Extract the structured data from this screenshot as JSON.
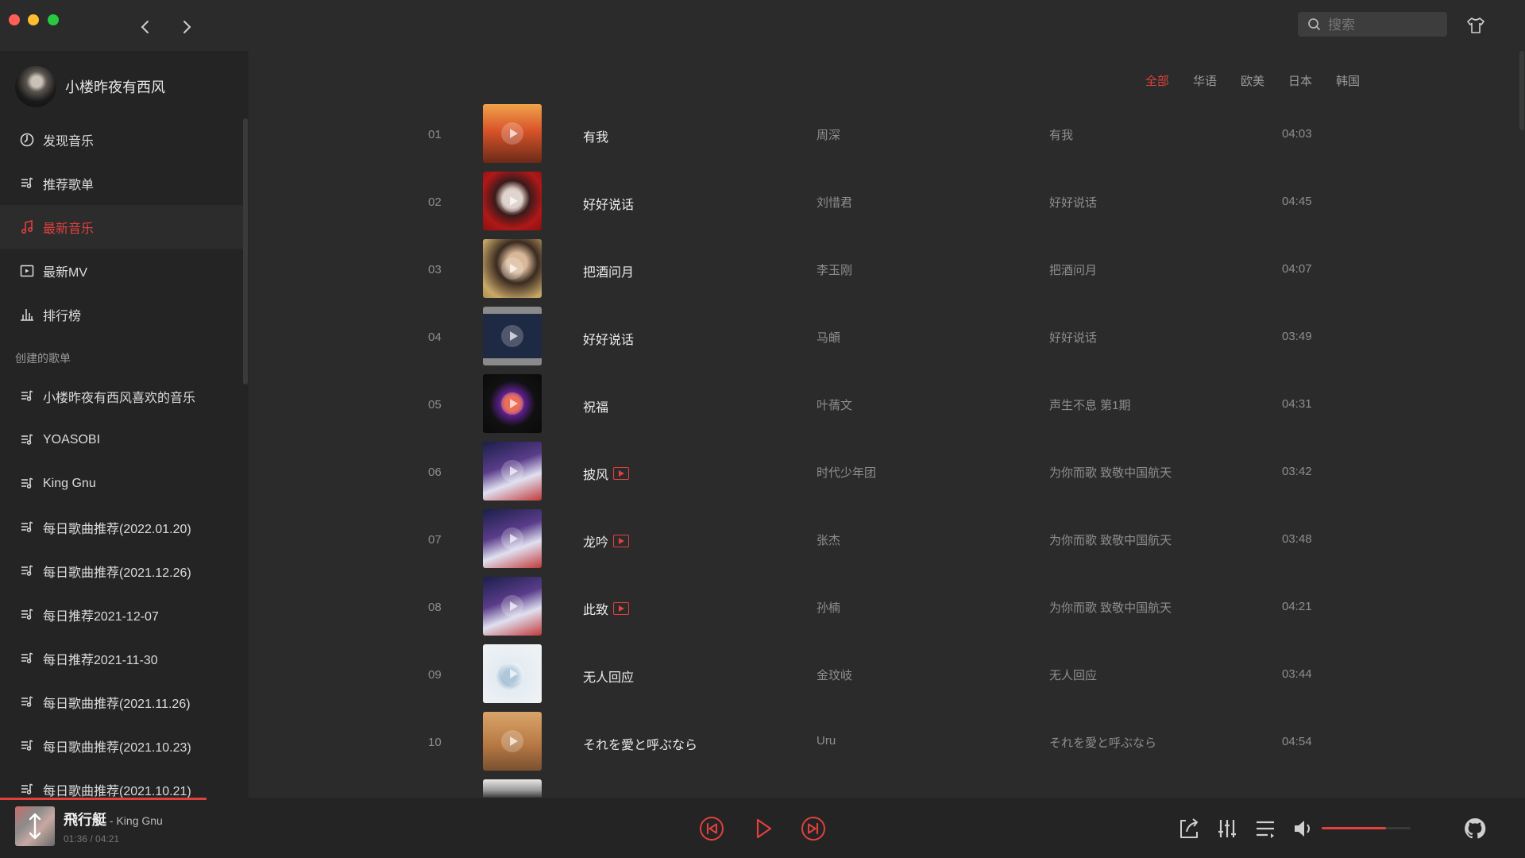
{
  "window": {
    "controls": {
      "close_color": "#ff5f57",
      "min_color": "#febc2e",
      "max_color": "#28c840"
    }
  },
  "search": {
    "placeholder": "搜索",
    "value": ""
  },
  "user": {
    "name": "小楼昨夜有西风"
  },
  "sidebar": {
    "main_menu": [
      {
        "label": "发现音乐",
        "icon": "discover-icon",
        "active": false
      },
      {
        "label": "推荐歌单",
        "icon": "playlist-icon",
        "active": false
      },
      {
        "label": "最新音乐",
        "icon": "music-note-icon",
        "active": true
      },
      {
        "label": "最新MV",
        "icon": "video-icon",
        "active": false
      },
      {
        "label": "排行榜",
        "icon": "chart-icon",
        "active": false
      }
    ],
    "section_title": "创建的歌单",
    "playlists": [
      {
        "label": "小楼昨夜有西风喜欢的音乐"
      },
      {
        "label": "YOASOBI"
      },
      {
        "label": "King Gnu"
      },
      {
        "label": "每日歌曲推荐(2022.01.20)"
      },
      {
        "label": "每日歌曲推荐(2021.12.26)"
      },
      {
        "label": "每日推荐2021-12-07"
      },
      {
        "label": "每日推荐2021-11-30"
      },
      {
        "label": "每日歌曲推荐(2021.11.26)"
      },
      {
        "label": "每日歌曲推荐(2021.10.23)"
      },
      {
        "label": "每日歌曲推荐(2021.10.21)"
      }
    ]
  },
  "tabs": [
    {
      "label": "全部",
      "active": true
    },
    {
      "label": "华语",
      "active": false
    },
    {
      "label": "欧美",
      "active": false
    },
    {
      "label": "日本",
      "active": false
    },
    {
      "label": "韩国",
      "active": false
    }
  ],
  "songs": [
    {
      "index": "01",
      "name": "有我",
      "artist": "周深",
      "album": "有我",
      "duration": "04:03",
      "mv": false
    },
    {
      "index": "02",
      "name": "好好说话",
      "artist": "刘惜君",
      "album": "好好说话",
      "duration": "04:45",
      "mv": false
    },
    {
      "index": "03",
      "name": "把酒问月",
      "artist": "李玉刚",
      "album": "把酒问月",
      "duration": "04:07",
      "mv": false
    },
    {
      "index": "04",
      "name": "好好说话",
      "artist": "马頔",
      "album": "好好说话",
      "duration": "03:49",
      "mv": false
    },
    {
      "index": "05",
      "name": "祝福",
      "artist": "叶蒨文",
      "album": "声生不息 第1期",
      "duration": "04:31",
      "mv": false
    },
    {
      "index": "06",
      "name": "披风",
      "artist": "时代少年团",
      "album": "为你而歌 致敬中国航天",
      "duration": "03:42",
      "mv": true
    },
    {
      "index": "07",
      "name": "龙吟",
      "artist": "张杰",
      "album": "为你而歌 致敬中国航天",
      "duration": "03:48",
      "mv": true
    },
    {
      "index": "08",
      "name": "此致",
      "artist": "孙楠",
      "album": "为你而歌 致敬中国航天",
      "duration": "04:21",
      "mv": true
    },
    {
      "index": "09",
      "name": "无人回应",
      "artist": "金玟岐",
      "album": "无人回应",
      "duration": "03:44",
      "mv": false
    },
    {
      "index": "10",
      "name": "それを愛と呼ぶなら",
      "artist": "Uru",
      "album": "それを愛と呼ぶなら",
      "duration": "04:54",
      "mv": false
    }
  ],
  "player": {
    "title": "飛行艇",
    "artist_sep": " - ",
    "artist": "King Gnu",
    "current_time": "01:36",
    "time_sep": " / ",
    "total_time": "04:21",
    "progress": 0.37,
    "volume": 0.72
  },
  "colors": {
    "accent": "#e0413d",
    "background": "#2b2b2b",
    "sidebar": "#242424"
  }
}
